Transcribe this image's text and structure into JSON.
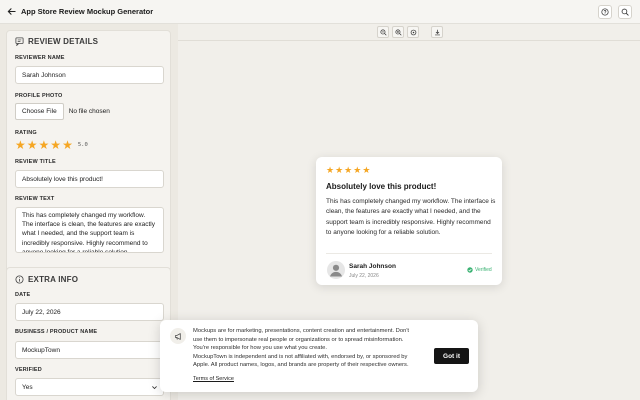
{
  "header": {
    "title": "App Store Review Mockup Generator",
    "back_icon": "arrow-left-icon",
    "help_icon": "help-circle-icon",
    "search_icon": "search-icon"
  },
  "review_details": {
    "heading": "REVIEW DETAILS",
    "reviewer_name_label": "REVIEWER NAME",
    "reviewer_name_value": "Sarah Johnson",
    "profile_photo_label": "PROFILE PHOTO",
    "choose_file_label": "Choose File",
    "no_file_text": "No file chosen",
    "rating_label": "RATING",
    "rating_stars": 5,
    "rating_value": "5.0",
    "review_title_label": "REVIEW TITLE",
    "review_title_value": "Absolutely love this product!",
    "review_text_label": "REVIEW TEXT",
    "review_text_value": "This has completely changed my workflow. The interface is clean, the features are exactly what I needed, and the support team is incredibly responsive. Highly recommend to anyone looking for a reliable solution."
  },
  "extra_info": {
    "heading": "EXTRA INFO",
    "date_label": "DATE",
    "date_value": "July 22, 2026",
    "business_label": "BUSINESS / PRODUCT NAME",
    "business_value": "MockupTown",
    "verified_label": "VERIFIED",
    "verified_value": "Yes"
  },
  "preview": {
    "stars": 5,
    "title": "Absolutely love this product!",
    "text": "This has completely changed my workflow. The interface is clean, the features are exactly what I needed, and the support team is incredibly responsive. Highly recommend to anyone looking for a reliable solution.",
    "name": "Sarah Johnson",
    "date": "July 22, 2026",
    "verified": "Verified"
  },
  "toolbar": {
    "icons": [
      "zoom-out-icon",
      "zoom-in-icon",
      "reset-zoom-icon",
      "download-icon"
    ]
  },
  "banner": {
    "line1": "Mockups are for marketing, presentations, content creation and entertainment. Don't",
    "line2": "use them to impersonate real people or organizations or to spread misinformation.",
    "line3": "You're responsible for how you use what you create.",
    "line4": "MockupTown is independent and is not affiliated with, endorsed by, or sponsored by",
    "line5": "Apple. All product names, logos, and brands are property of their respective owners.",
    "tos": "Terms of Service",
    "button": "Got it"
  },
  "colors": {
    "star": "#f5a623",
    "verified": "#3bb273",
    "button": "#151515"
  }
}
